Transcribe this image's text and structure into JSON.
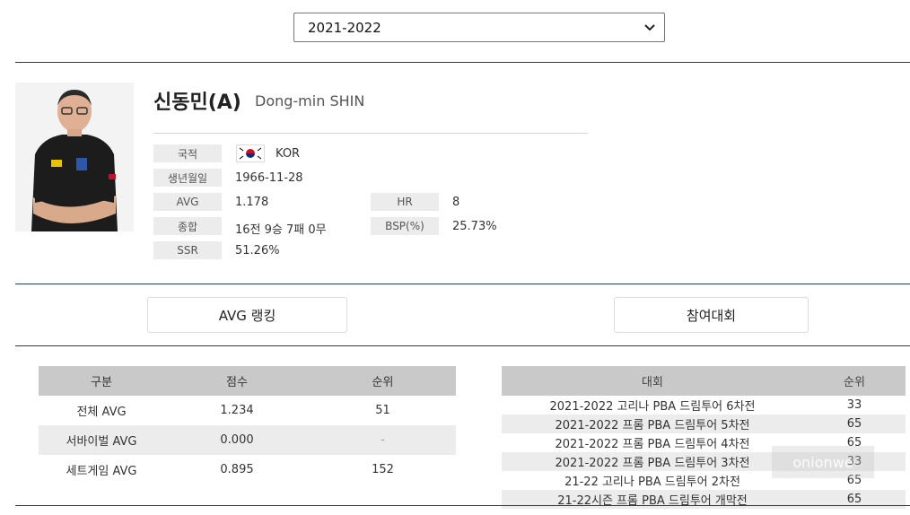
{
  "season_select": {
    "value": "2021-2022"
  },
  "player": {
    "name_ko": "신동민(A)",
    "name_en": "Dong-min SHIN",
    "fields": {
      "nationality": {
        "label": "국적",
        "value": "KOR"
      },
      "birth": {
        "label": "생년월일",
        "value": "1966-11-28"
      },
      "avg": {
        "label": "AVG",
        "value": "1.178"
      },
      "hr": {
        "label": "HR",
        "value": "8"
      },
      "record": {
        "label": "종합",
        "value": "16전 9승 7패 0무"
      },
      "bsp": {
        "label": "BSP(%)",
        "value": "25.73%"
      },
      "ssr": {
        "label": "SSR",
        "value": "51.26%"
      }
    }
  },
  "tabs": {
    "avg_ranking": "AVG 랭킹",
    "tournaments": "참여대회"
  },
  "avg_table": {
    "headers": [
      "구분",
      "점수",
      "순위"
    ],
    "rows": [
      [
        "전체 AVG",
        "1.234",
        "51"
      ],
      [
        "서바이벌 AVG",
        "0.000",
        "-"
      ],
      [
        "세트게임 AVG",
        "0.895",
        "152"
      ]
    ]
  },
  "comp_table": {
    "headers": [
      "대회",
      "순위"
    ],
    "rows": [
      [
        "2021-2022 고리나 PBA 드림투어 6차전",
        "33"
      ],
      [
        "2021-2022 프롬 PBA 드림투어 5차전",
        "65"
      ],
      [
        "2021-2022 프롬 PBA 드림투어 4차전",
        "65"
      ],
      [
        "2021-2022 프롬 PBA 드림투어 3차전",
        "33"
      ],
      [
        "21-22 고리나 PBA 드림투어 2차전",
        "65"
      ],
      [
        "21-22시즌 프롬 PBA 드림투어 개막전",
        "65"
      ]
    ]
  },
  "watermark": "onionwe",
  "colors": {
    "rule": "#1f3f5a",
    "header_bg": "#c9c9c9",
    "label_bg": "#ececec"
  }
}
